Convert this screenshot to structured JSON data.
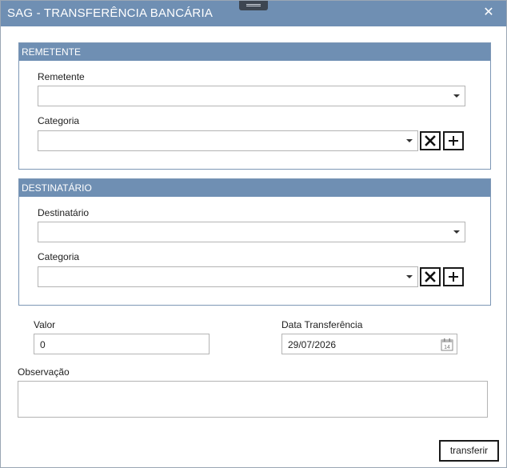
{
  "window": {
    "title": "SAG - TRANSFERÊNCIA BANCÁRIA",
    "close_symbol": "✕"
  },
  "remetente": {
    "header": "REMETENTE",
    "remetente_label": "Remetente",
    "remetente_value": "",
    "categoria_label": "Categoria",
    "categoria_value": ""
  },
  "destinatario": {
    "header": "DESTINATÁRIO",
    "destinatario_label": "Destinatário",
    "destinatario_value": "",
    "categoria_label": "Categoria",
    "categoria_value": ""
  },
  "valor": {
    "label": "Valor",
    "value": "0"
  },
  "data_transferencia": {
    "label": "Data Transferência",
    "value": "29/07/2026",
    "calendar_day": "14"
  },
  "observacao": {
    "label": "Observação",
    "value": ""
  },
  "actions": {
    "transferir_label": "transferir"
  },
  "colors": {
    "accent": "#6f8fb3",
    "group_border": "#7d97b5"
  },
  "icons": [
    "close-icon",
    "dropdown-arrow-icon",
    "remove-icon",
    "add-icon",
    "calendar-icon"
  ]
}
